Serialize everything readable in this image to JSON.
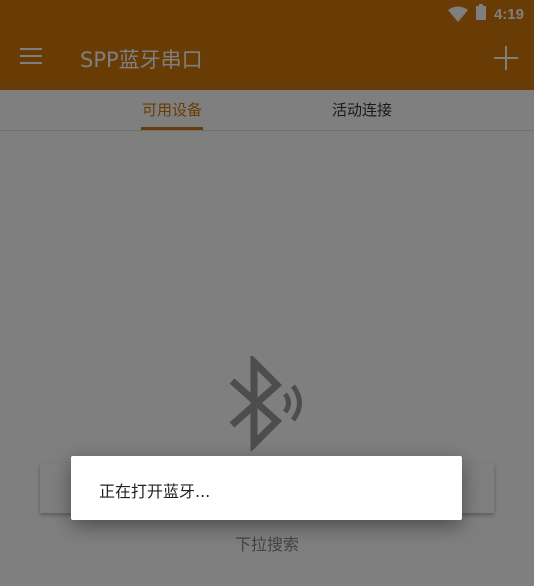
{
  "status_bar": {
    "time": "4:19",
    "wifi_icon": "wifi-icon",
    "battery_icon": "battery-icon"
  },
  "app_bar": {
    "title": "SPP蓝牙串口",
    "menu_icon": "menu-icon",
    "add_icon": "add-icon"
  },
  "tabs": [
    {
      "label": "可用设备",
      "selected": true
    },
    {
      "label": "活动连接",
      "selected": false
    }
  ],
  "content": {
    "bluetooth_icon": "bluetooth-searching-icon",
    "pull_hint": "下拉搜索"
  },
  "dialog": {
    "message": "正在打开蓝牙..."
  },
  "colors": {
    "primary": "#d2780b",
    "scrim": "rgba(0,0,0,0.5)"
  }
}
